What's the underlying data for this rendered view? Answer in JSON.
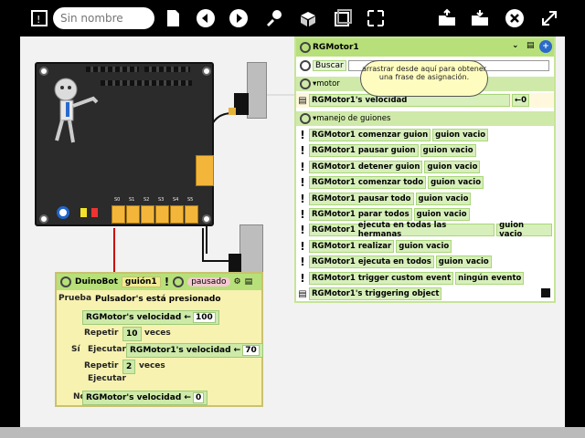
{
  "toolbar": {
    "name_placeholder": "Sin nombre"
  },
  "script": {
    "object": "DuinoBot",
    "script_name": "guión1",
    "status": "pausado",
    "test_label": "Prueba",
    "test_expr": "Pulsador's está presionado",
    "then_label": "Sí",
    "else_label": "No",
    "set1_target": "RGMotor's",
    "set1_prop": "velocidad",
    "set1_op": "←",
    "set1_val": "100",
    "repeat1_label": "Repetir",
    "repeat1_count": "10",
    "repeat1_unit": "veces",
    "execute1_label": "Ejecutar",
    "execute1_target": "RGMotor1's",
    "execute1_prop": "velocidad",
    "execute1_op": "←",
    "execute1_val": "70",
    "repeat2_label": "Repetir",
    "repeat2_count": "2",
    "repeat2_unit": "veces",
    "execute2_label": "Ejecutar",
    "else_target": "RGMotor's",
    "else_prop": "velocidad",
    "else_op": "←",
    "else_val": "0"
  },
  "viewer": {
    "title": "RGMotor1",
    "search_label": "Buscar",
    "balloon": "arrastrar desde aquí para obtener una frase de asignación.",
    "category_motor": "motor",
    "velocity_row": "RGMotor1's velocidad",
    "velocity_val": "0",
    "category_scripts": "manejo de guiones",
    "rows": [
      {
        "subject": "RGMotor1",
        "verb": "comenzar guion",
        "arg": "guion vacio"
      },
      {
        "subject": "RGMotor1",
        "verb": "pausar guion",
        "arg": "guion vacio"
      },
      {
        "subject": "RGMotor1",
        "verb": "detener guion",
        "arg": "guion vacio"
      },
      {
        "subject": "RGMotor1",
        "verb": "comenzar todo",
        "arg": "guion vacio"
      },
      {
        "subject": "RGMotor1",
        "verb": "pausar todo",
        "arg": "guion vacio"
      },
      {
        "subject": "RGMotor1",
        "verb": "parar todos",
        "arg": "guion vacio"
      },
      {
        "subject": "RGMotor1",
        "verb": "ejecuta en todas las hermanas",
        "arg": "guion vacio"
      },
      {
        "subject": "RGMotor1",
        "verb": "realizar",
        "arg": "guion vacio"
      },
      {
        "subject": "RGMotor1",
        "verb": "ejecuta en todos",
        "arg": "guion vacio"
      },
      {
        "subject": "RGMotor1",
        "verb": "trigger custom event",
        "arg": "ningún evento"
      }
    ],
    "last_row": "RGMotor1's triggering object"
  },
  "board": {
    "port_labels": [
      "S0",
      "S1",
      "S2",
      "S3",
      "S4",
      "S5"
    ]
  }
}
